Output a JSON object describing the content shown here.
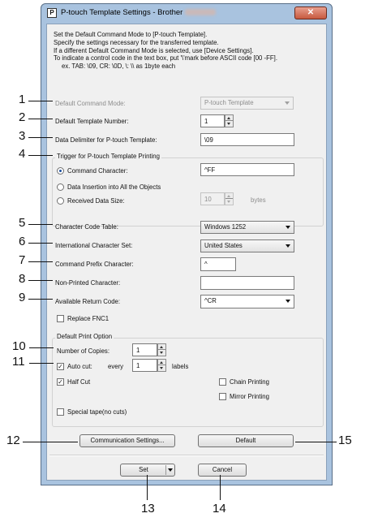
{
  "window": {
    "title": "P-touch Template Settings - Brother",
    "app_icon_glyph": "P",
    "close_glyph": "✕"
  },
  "info_lines": [
    "Set the Default Command Mode to [P-touch Template].",
    "Specify the settings necessary for the transferred template.",
    "If a different Default Command Mode is selected, use [Device Settings].",
    "To indicate a control code in the text box, put '\\'mark before ASCII code [00 -FF].",
    "ex. TAB: \\09,  CR: \\0D,  \\: \\\\  as 1byte each"
  ],
  "fields": {
    "default_command_mode": {
      "label": "Default Command Mode:",
      "value": "P-touch Template"
    },
    "default_template_number": {
      "label": "Default Template Number:",
      "value": "1"
    },
    "data_delimiter": {
      "label": "Data Delimiter for P-touch Template:",
      "value": "\\09"
    },
    "character_code_table": {
      "label": "Character Code Table:",
      "value": "Windows 1252"
    },
    "international_character_set": {
      "label": "International Character Set:",
      "value": "United States"
    },
    "command_prefix_character": {
      "label": "Command Prefix Character:",
      "value": "^"
    },
    "non_printed_character": {
      "label": "Non-Printed Character:",
      "value": ""
    },
    "available_return_code": {
      "label": "Available Return Code:",
      "value": "^CR"
    }
  },
  "trigger_group": {
    "title": "Trigger for P-touch Template Printing",
    "command_character": {
      "label": "Command Character:",
      "value": "^FF",
      "checked": true
    },
    "data_insertion": {
      "label": "Data Insertion into All the Objects",
      "checked": false
    },
    "received_data_size": {
      "label": "Received Data Size:",
      "value": "10",
      "unit": "bytes",
      "checked": false
    }
  },
  "replace_fnc1": {
    "label": "Replace FNC1",
    "checked": false
  },
  "print_option": {
    "title": "Default Print Option",
    "number_of_copies": {
      "label": "Number of Copies:",
      "value": "1"
    },
    "auto_cut": {
      "label": "Auto cut:",
      "every": "every",
      "value": "1",
      "unit": "labels",
      "checked": true
    },
    "half_cut": {
      "label": "Half Cut",
      "checked": true
    },
    "chain_printing": {
      "label": "Chain Printing",
      "checked": false
    },
    "mirror_printing": {
      "label": "Mirror Printing",
      "checked": false
    },
    "special_tape": {
      "label": "Special tape(no cuts)",
      "checked": false
    }
  },
  "buttons": {
    "communication_settings": "Communication Settings...",
    "default": "Default",
    "set": "Set",
    "cancel": "Cancel"
  },
  "check_glyph": "✓",
  "callouts": {
    "n1": "1",
    "n2": "2",
    "n3": "3",
    "n4": "4",
    "n5": "5",
    "n6": "6",
    "n7": "7",
    "n8": "8",
    "n9": "9",
    "n10": "10",
    "n11": "11",
    "n12": "12",
    "n13": "13",
    "n14": "14",
    "n15": "15"
  }
}
